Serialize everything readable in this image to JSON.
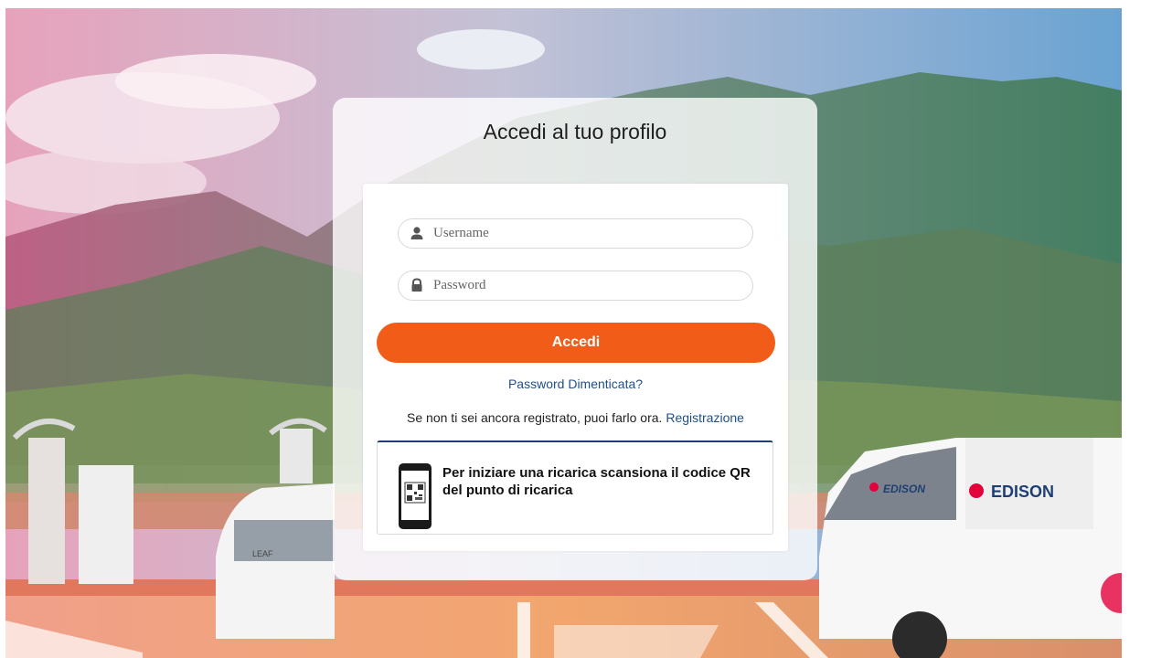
{
  "login": {
    "title": "Accedi al tuo profilo",
    "username_placeholder": "Username",
    "password_placeholder": "Password",
    "submit_label": "Accedi",
    "forgot_password_label": "Password Dimenticata?",
    "register_prompt": "Se non ti sei ancora registrato, puoi farlo ora.",
    "register_link_label": "Registrazione",
    "qr_hint": "Per iniziare una ricarica scansiona il codice QR del punto di ricarica"
  },
  "background": {
    "van_brand": "EDISON",
    "van_door_brand": "EDISON",
    "car_model": "LEAF"
  },
  "icons": {
    "username": "user-icon",
    "password": "lock-icon",
    "qr": "phone-qr-icon"
  },
  "colors": {
    "primary_button": "#f25c19",
    "link": "#1f4e8c",
    "qr_box_accent": "#1e3f73"
  }
}
